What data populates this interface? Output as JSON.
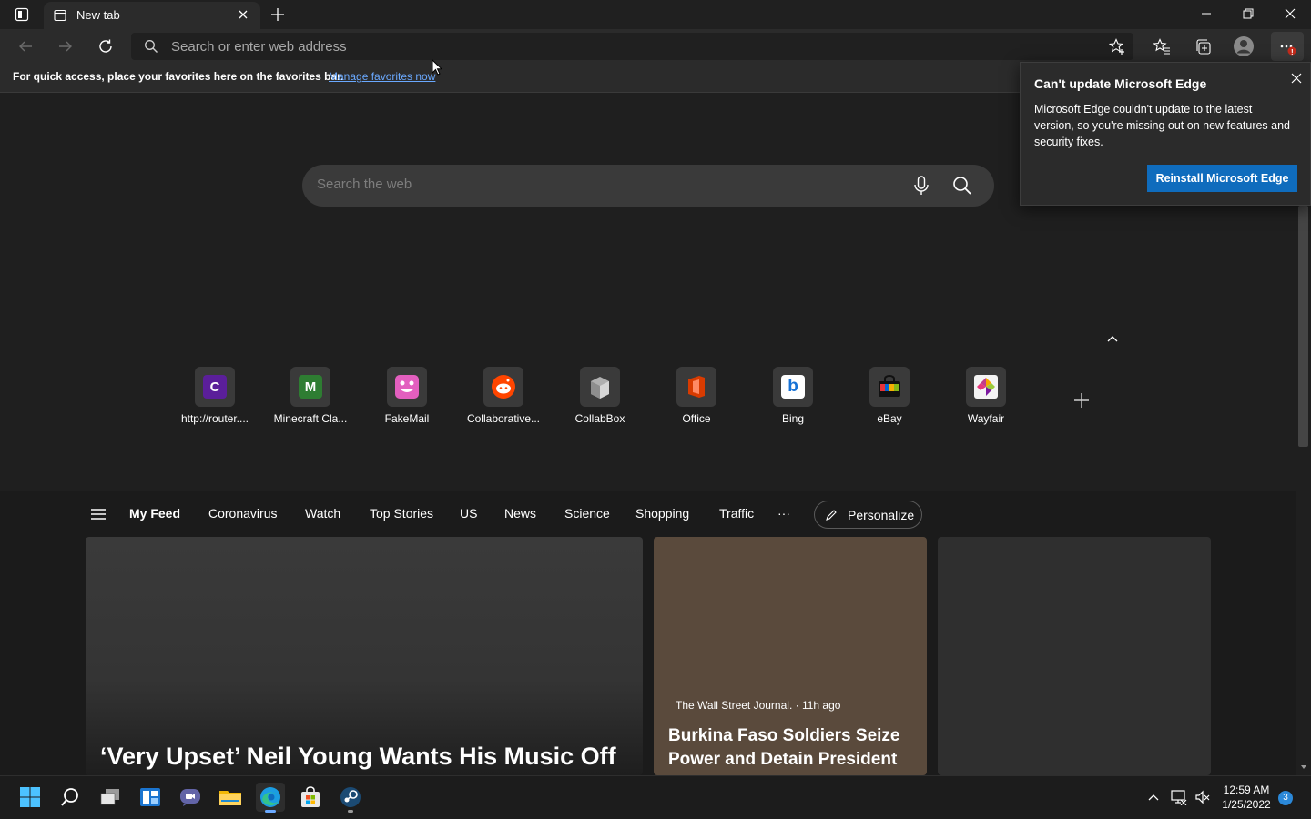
{
  "browser": {
    "tab": {
      "title": "New tab"
    },
    "address": {
      "placeholder": "Search or enter web address"
    },
    "favorites_bar": {
      "message": "For quick access, place your favorites here on the favorites bar.",
      "link": "Manage favorites now"
    },
    "menu_badge": "!"
  },
  "newtab": {
    "search_placeholder": "Search the web",
    "quick_links": [
      {
        "label": "http://router....",
        "icon": "C",
        "icon_bg": "#5b1f9a"
      },
      {
        "label": "Minecraft Cla...",
        "icon": "M",
        "icon_bg": "#2e7d32"
      },
      {
        "label": "FakeMail",
        "icon": "fakemail-icon",
        "icon_bg": "#e35fbf"
      },
      {
        "label": "Collaborative...",
        "icon": "reddit-icon",
        "icon_bg": "#ff4500"
      },
      {
        "label": "CollabBox",
        "icon": "collabbox-icon",
        "icon_bg": "#8a8a8a"
      },
      {
        "label": "Office",
        "icon": "office-icon",
        "icon_bg": "#d83b01"
      },
      {
        "label": "Bing",
        "icon": "b",
        "icon_bg": "#ffffff"
      },
      {
        "label": "eBay",
        "icon": "ebay-icon",
        "icon_bg": "#3a3a3a"
      },
      {
        "label": "Wayfair",
        "icon": "wayfair-icon",
        "icon_bg": "#7b189f"
      }
    ],
    "feed_nav": [
      "My Feed",
      "Coronavirus",
      "Watch",
      "Top Stories",
      "US",
      "News",
      "Science",
      "Shopping",
      "Traffic",
      "···"
    ],
    "personalize": "Personalize",
    "cards": [
      {
        "headline": "‘Very Upset’ Neil Young Wants His Music Off"
      },
      {
        "source": "The Wall Street Journal. · 11h ago",
        "headline": "Burkina Faso Soldiers Seize Power and Detain President"
      }
    ]
  },
  "popup": {
    "title": "Can't update Microsoft Edge",
    "body": "Microsoft Edge couldn't update to the latest version, so you're missing out on new features and security fixes.",
    "button": "Reinstall Microsoft Edge"
  },
  "taskbar": {
    "time": "12:59 AM",
    "date": "1/25/2022",
    "notification_count": "3"
  },
  "colors": {
    "accent": "#0f6cbd",
    "link": "#6aa9ff"
  }
}
